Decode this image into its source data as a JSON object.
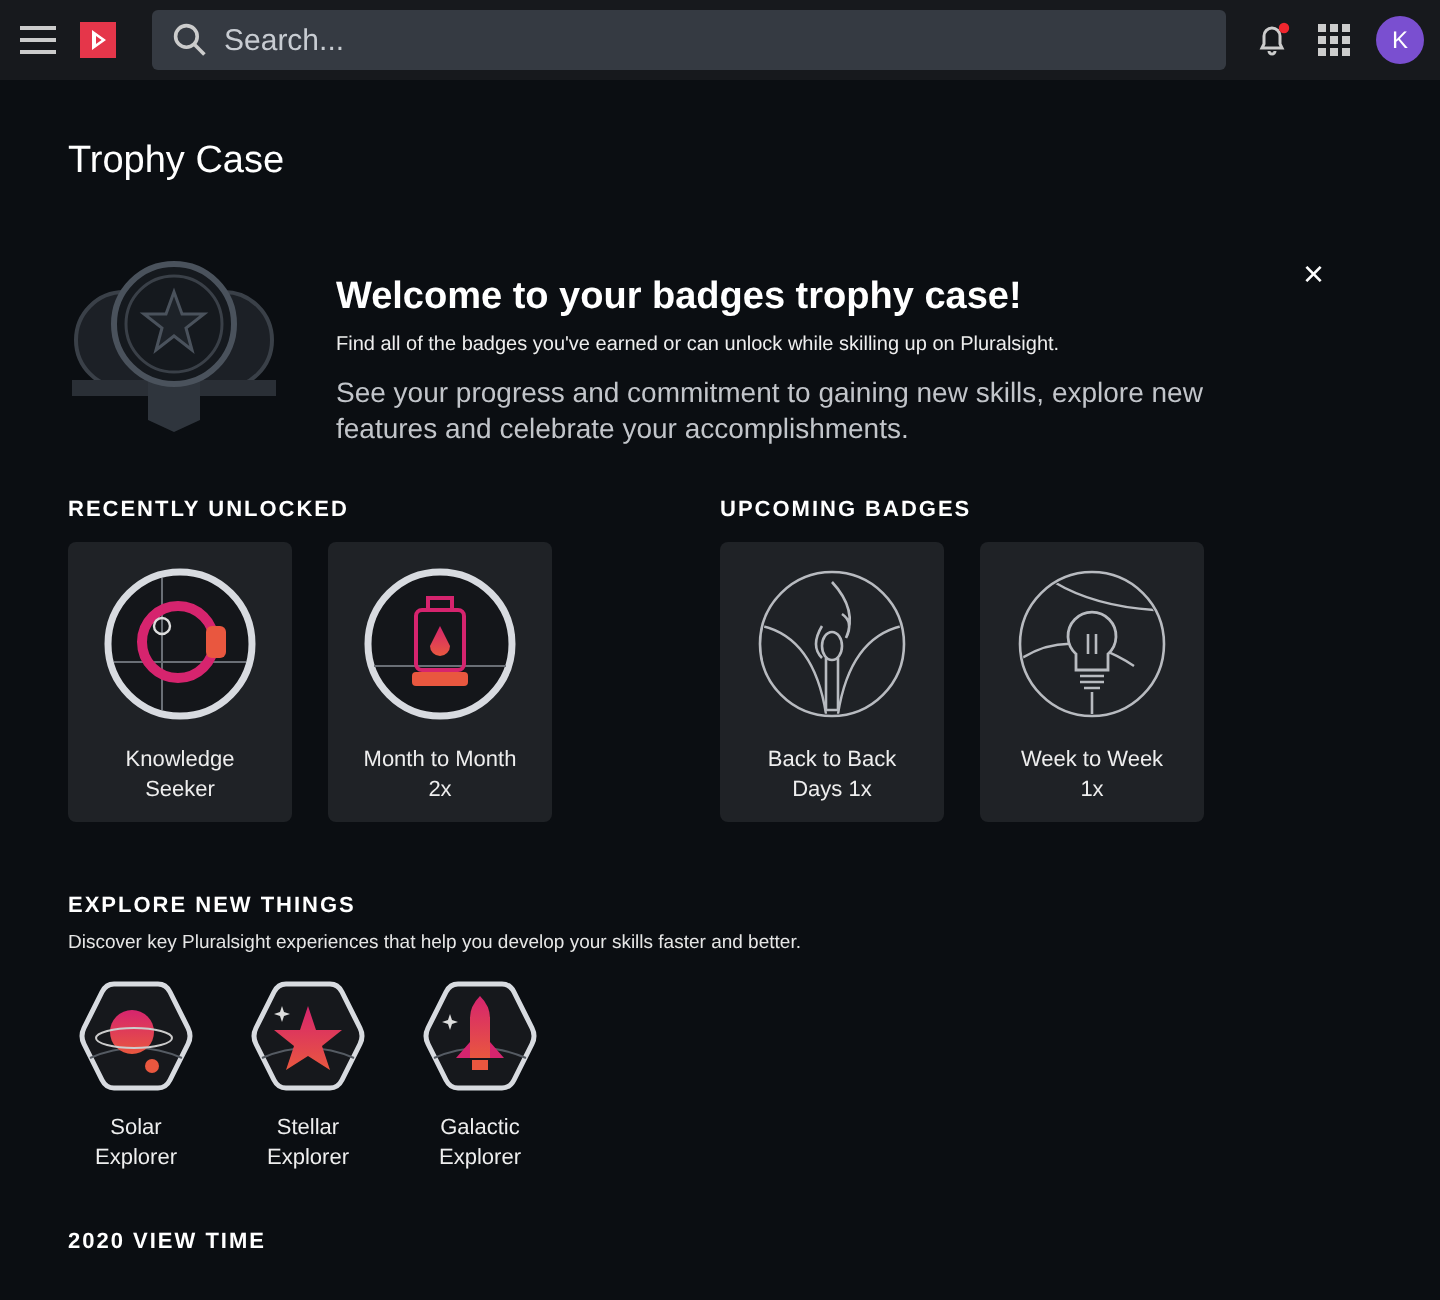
{
  "topbar": {
    "search": {
      "placeholder": "Search..."
    },
    "notifications": {
      "unread": true
    },
    "avatar": {
      "initial": "K"
    }
  },
  "page_title": "Trophy Case",
  "welcome": {
    "title": "Welcome to your badges trophy case!",
    "subtitle": "Find all of the badges you've earned or can unlock while skilling up on Pluralsight.",
    "body": "See your progress and commitment to gaining new skills, explore new features and celebrate your accomplishments.",
    "close": "×"
  },
  "groups": [
    {
      "heading": "RECENTLY UNLOCKED",
      "kind": "cards",
      "badges": [
        {
          "lines": [
            "Knowledge",
            "Seeker"
          ],
          "unlocked": true
        },
        {
          "lines": [
            "Month to Month",
            "2x"
          ],
          "unlocked": true
        }
      ]
    },
    {
      "heading": "UPCOMING BADGES",
      "kind": "cards",
      "badges": [
        {
          "lines": [
            "Back to Back",
            "Days 1x"
          ],
          "unlocked": false
        },
        {
          "lines": [
            "Week to Week",
            "1x"
          ],
          "unlocked": false
        }
      ]
    }
  ],
  "explore": {
    "heading": "EXPLORE NEW THINGS",
    "description": "Discover key Pluralsight experiences that help you develop your skills faster and better.",
    "badges": [
      {
        "lines": [
          "Solar",
          "Explorer"
        ]
      },
      {
        "lines": [
          "Stellar",
          "Explorer"
        ]
      },
      {
        "lines": [
          "Galactic",
          "Explorer"
        ]
      }
    ]
  },
  "next_section": {
    "heading": "2020 VIEW TIME"
  }
}
